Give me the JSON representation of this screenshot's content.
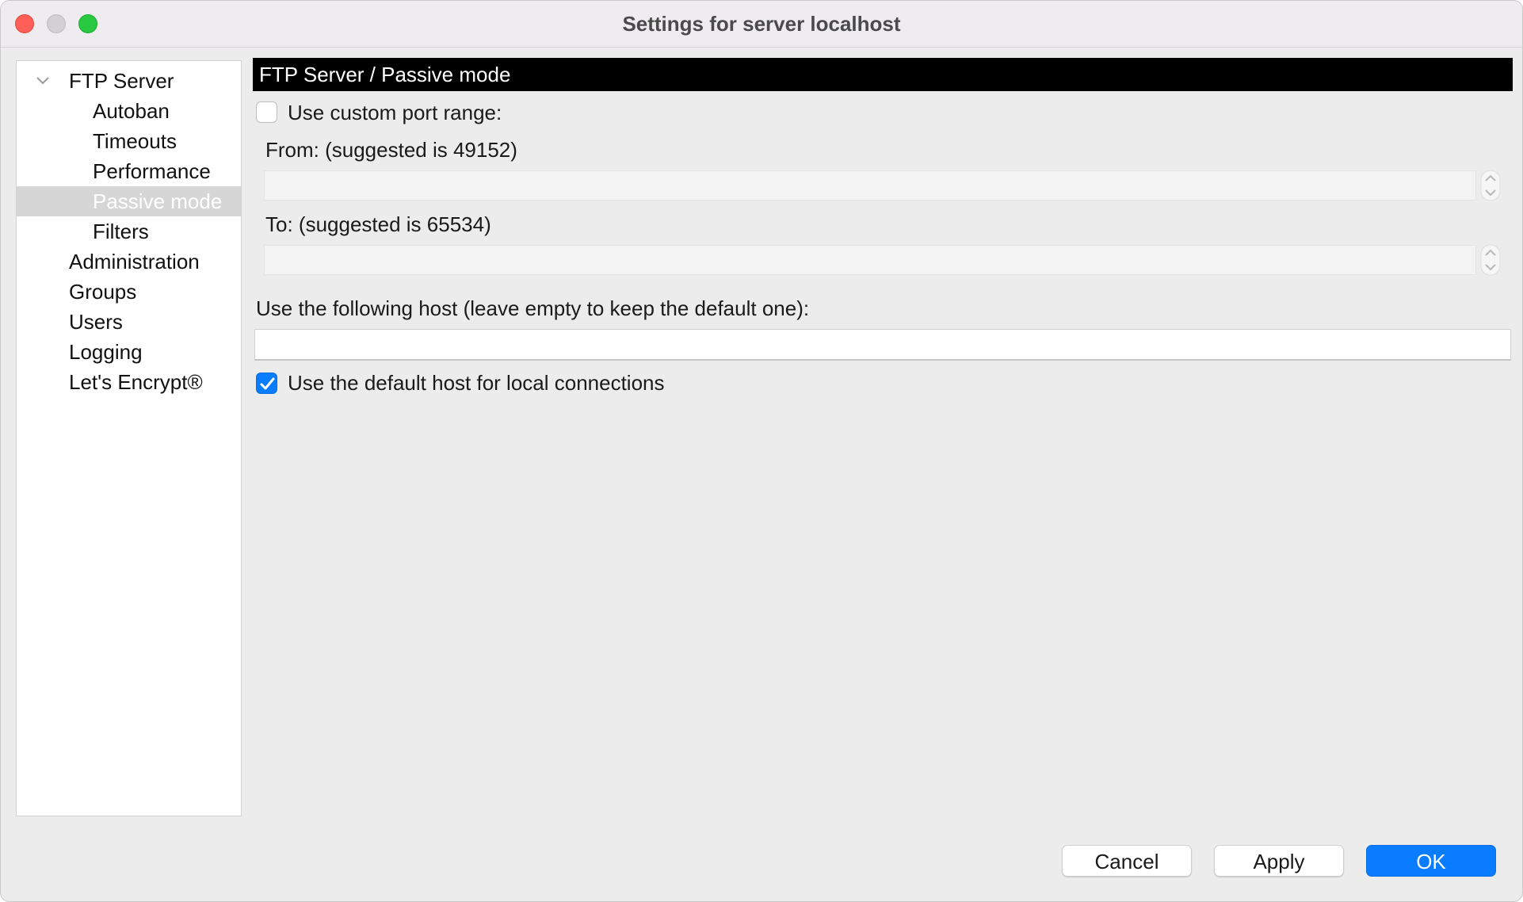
{
  "window": {
    "title": "Settings for server localhost"
  },
  "sidebar": {
    "items": [
      {
        "label": "FTP Server",
        "expanded": true,
        "selected": false
      },
      {
        "label": "Autoban",
        "selected": false
      },
      {
        "label": "Timeouts",
        "selected": false
      },
      {
        "label": "Performance",
        "selected": false
      },
      {
        "label": "Passive mode",
        "selected": true
      },
      {
        "label": "Filters",
        "selected": false
      },
      {
        "label": "Administration",
        "selected": false
      },
      {
        "label": "Groups",
        "selected": false
      },
      {
        "label": "Users",
        "selected": false
      },
      {
        "label": "Logging",
        "selected": false
      },
      {
        "label": "Let's Encrypt®",
        "selected": false
      }
    ]
  },
  "content": {
    "header": "FTP Server / Passive mode",
    "custom_port_range": {
      "label": "Use custom port range:",
      "checked": false
    },
    "from": {
      "label": "From: (suggested is 49152)",
      "value": ""
    },
    "to": {
      "label": "To: (suggested is 65534)",
      "value": ""
    },
    "host": {
      "label": "Use the following host (leave empty to keep the default one):",
      "value": ""
    },
    "default_host_local": {
      "label": "Use the default host for local connections",
      "checked": true
    }
  },
  "buttons": {
    "cancel": "Cancel",
    "apply": "Apply",
    "ok": "OK"
  },
  "colors": {
    "accent": "#0a7cff",
    "header_bg": "#000000",
    "selection_bg": "#d6d6d6",
    "close": "#ff5f57",
    "zoom": "#28c840"
  }
}
